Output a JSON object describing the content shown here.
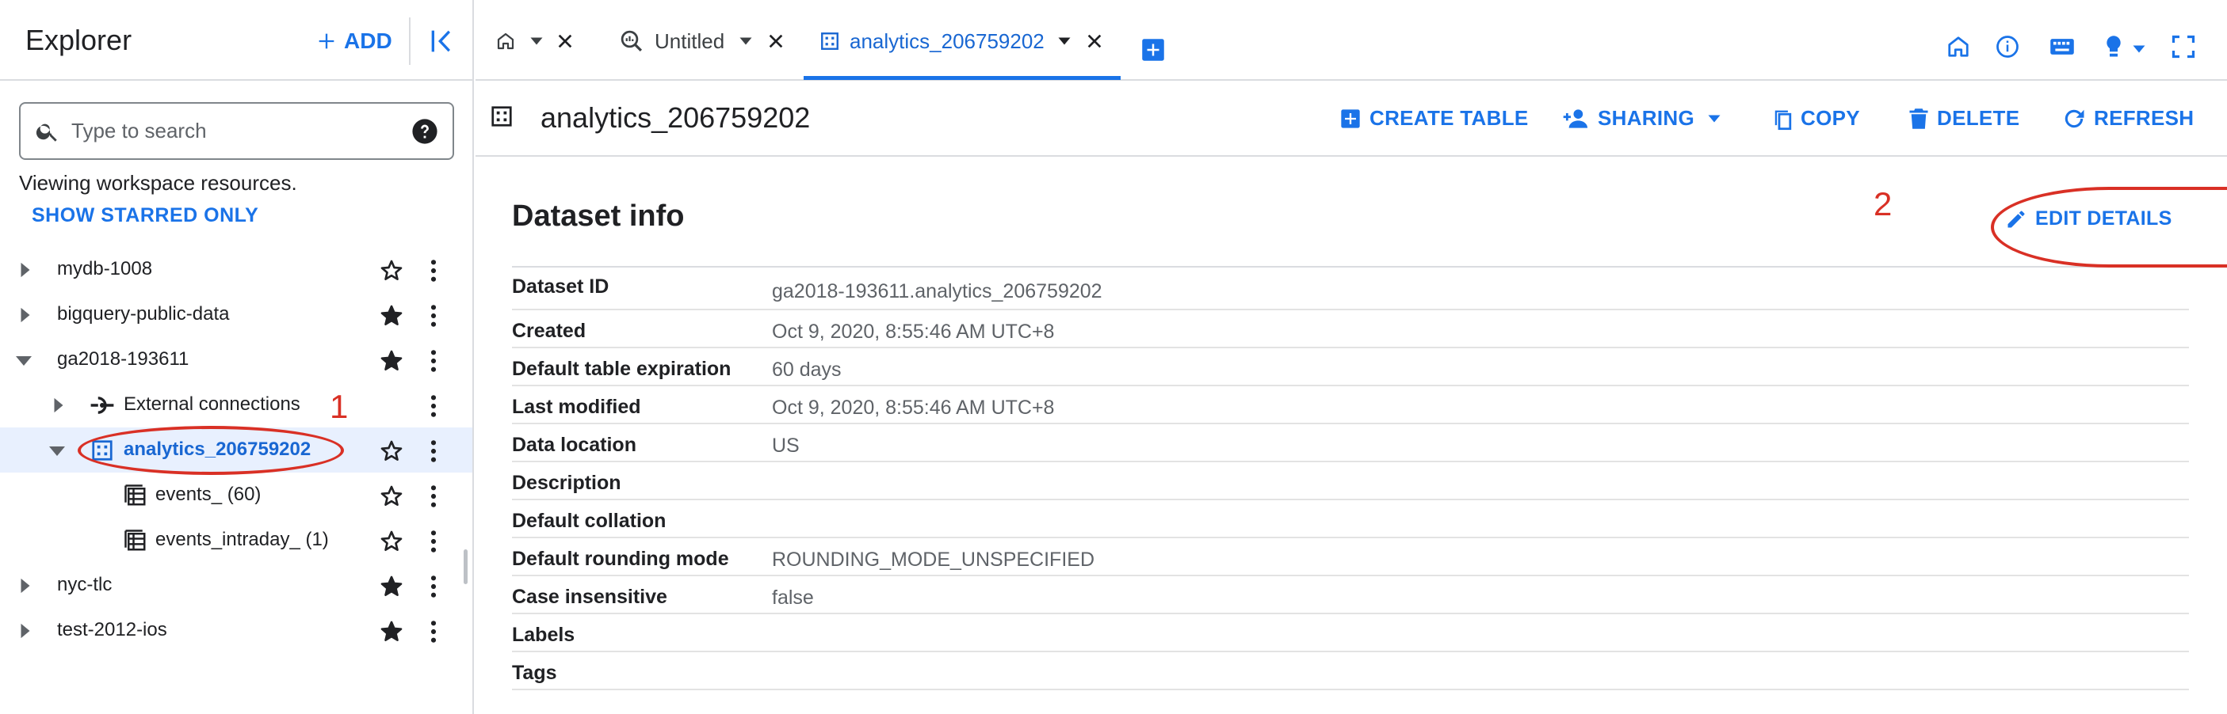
{
  "explorer": {
    "title": "Explorer",
    "add_label": "ADD",
    "search_placeholder": "Type to search",
    "viewing_text": "Viewing workspace resources.",
    "starred_label": "SHOW STARRED ONLY",
    "tree": [
      {
        "label": "mydb-1008",
        "level": 0,
        "expanded": false,
        "starred": false
      },
      {
        "label": "bigquery-public-data",
        "level": 0,
        "expanded": false,
        "starred": true
      },
      {
        "label": "ga2018-193611",
        "level": 0,
        "expanded": true,
        "starred": true
      },
      {
        "label": "External connections",
        "level": 1,
        "expanded": false,
        "icon": "connection-icon"
      },
      {
        "label": "analytics_206759202",
        "level": 1,
        "expanded": true,
        "starred": false,
        "selected": true,
        "icon": "dataset-icon"
      },
      {
        "label": "events_ (60)",
        "level": 2,
        "starred": false,
        "icon": "table-icon"
      },
      {
        "label": "events_intraday_ (1)",
        "level": 2,
        "starred": false,
        "icon": "table-icon"
      },
      {
        "label": "nyc-tlc",
        "level": 0,
        "expanded": false,
        "starred": true
      },
      {
        "label": "test-2012-ios",
        "level": 0,
        "expanded": false,
        "starred": true
      }
    ]
  },
  "tabs": [
    {
      "label": "",
      "icon": "home-icon"
    },
    {
      "label": "Untitled",
      "icon": "query-icon"
    },
    {
      "label": "analytics_206759202",
      "icon": "dataset-icon",
      "active": true
    }
  ],
  "toolbar": {
    "dataset_name": "analytics_206759202",
    "create_table": "CREATE TABLE",
    "sharing": "SHARING",
    "copy": "COPY",
    "delete": "DELETE",
    "refresh": "REFRESH"
  },
  "dataset_info": {
    "title": "Dataset info",
    "edit_details": "EDIT DETAILS",
    "rows": [
      {
        "key": "Dataset ID",
        "value": "ga2018-193611.analytics_206759202"
      },
      {
        "key": "Created",
        "value": "Oct 9, 2020, 8:55:46 AM UTC+8"
      },
      {
        "key": "Default table expiration",
        "value": "60 days"
      },
      {
        "key": "Last modified",
        "value": "Oct 9, 2020, 8:55:46 AM UTC+8"
      },
      {
        "key": "Data location",
        "value": "US"
      },
      {
        "key": "Description",
        "value": ""
      },
      {
        "key": "Default collation",
        "value": ""
      },
      {
        "key": "Default rounding mode",
        "value": "ROUNDING_MODE_UNSPECIFIED"
      },
      {
        "key": "Case insensitive",
        "value": "false"
      },
      {
        "key": "Labels",
        "value": ""
      },
      {
        "key": "Tags",
        "value": ""
      }
    ]
  },
  "annotations": {
    "one": "1",
    "two": "2"
  },
  "colors": {
    "accent": "#1a73e8",
    "annotation": "#d93025",
    "selected_bg": "#e8f0fe"
  }
}
